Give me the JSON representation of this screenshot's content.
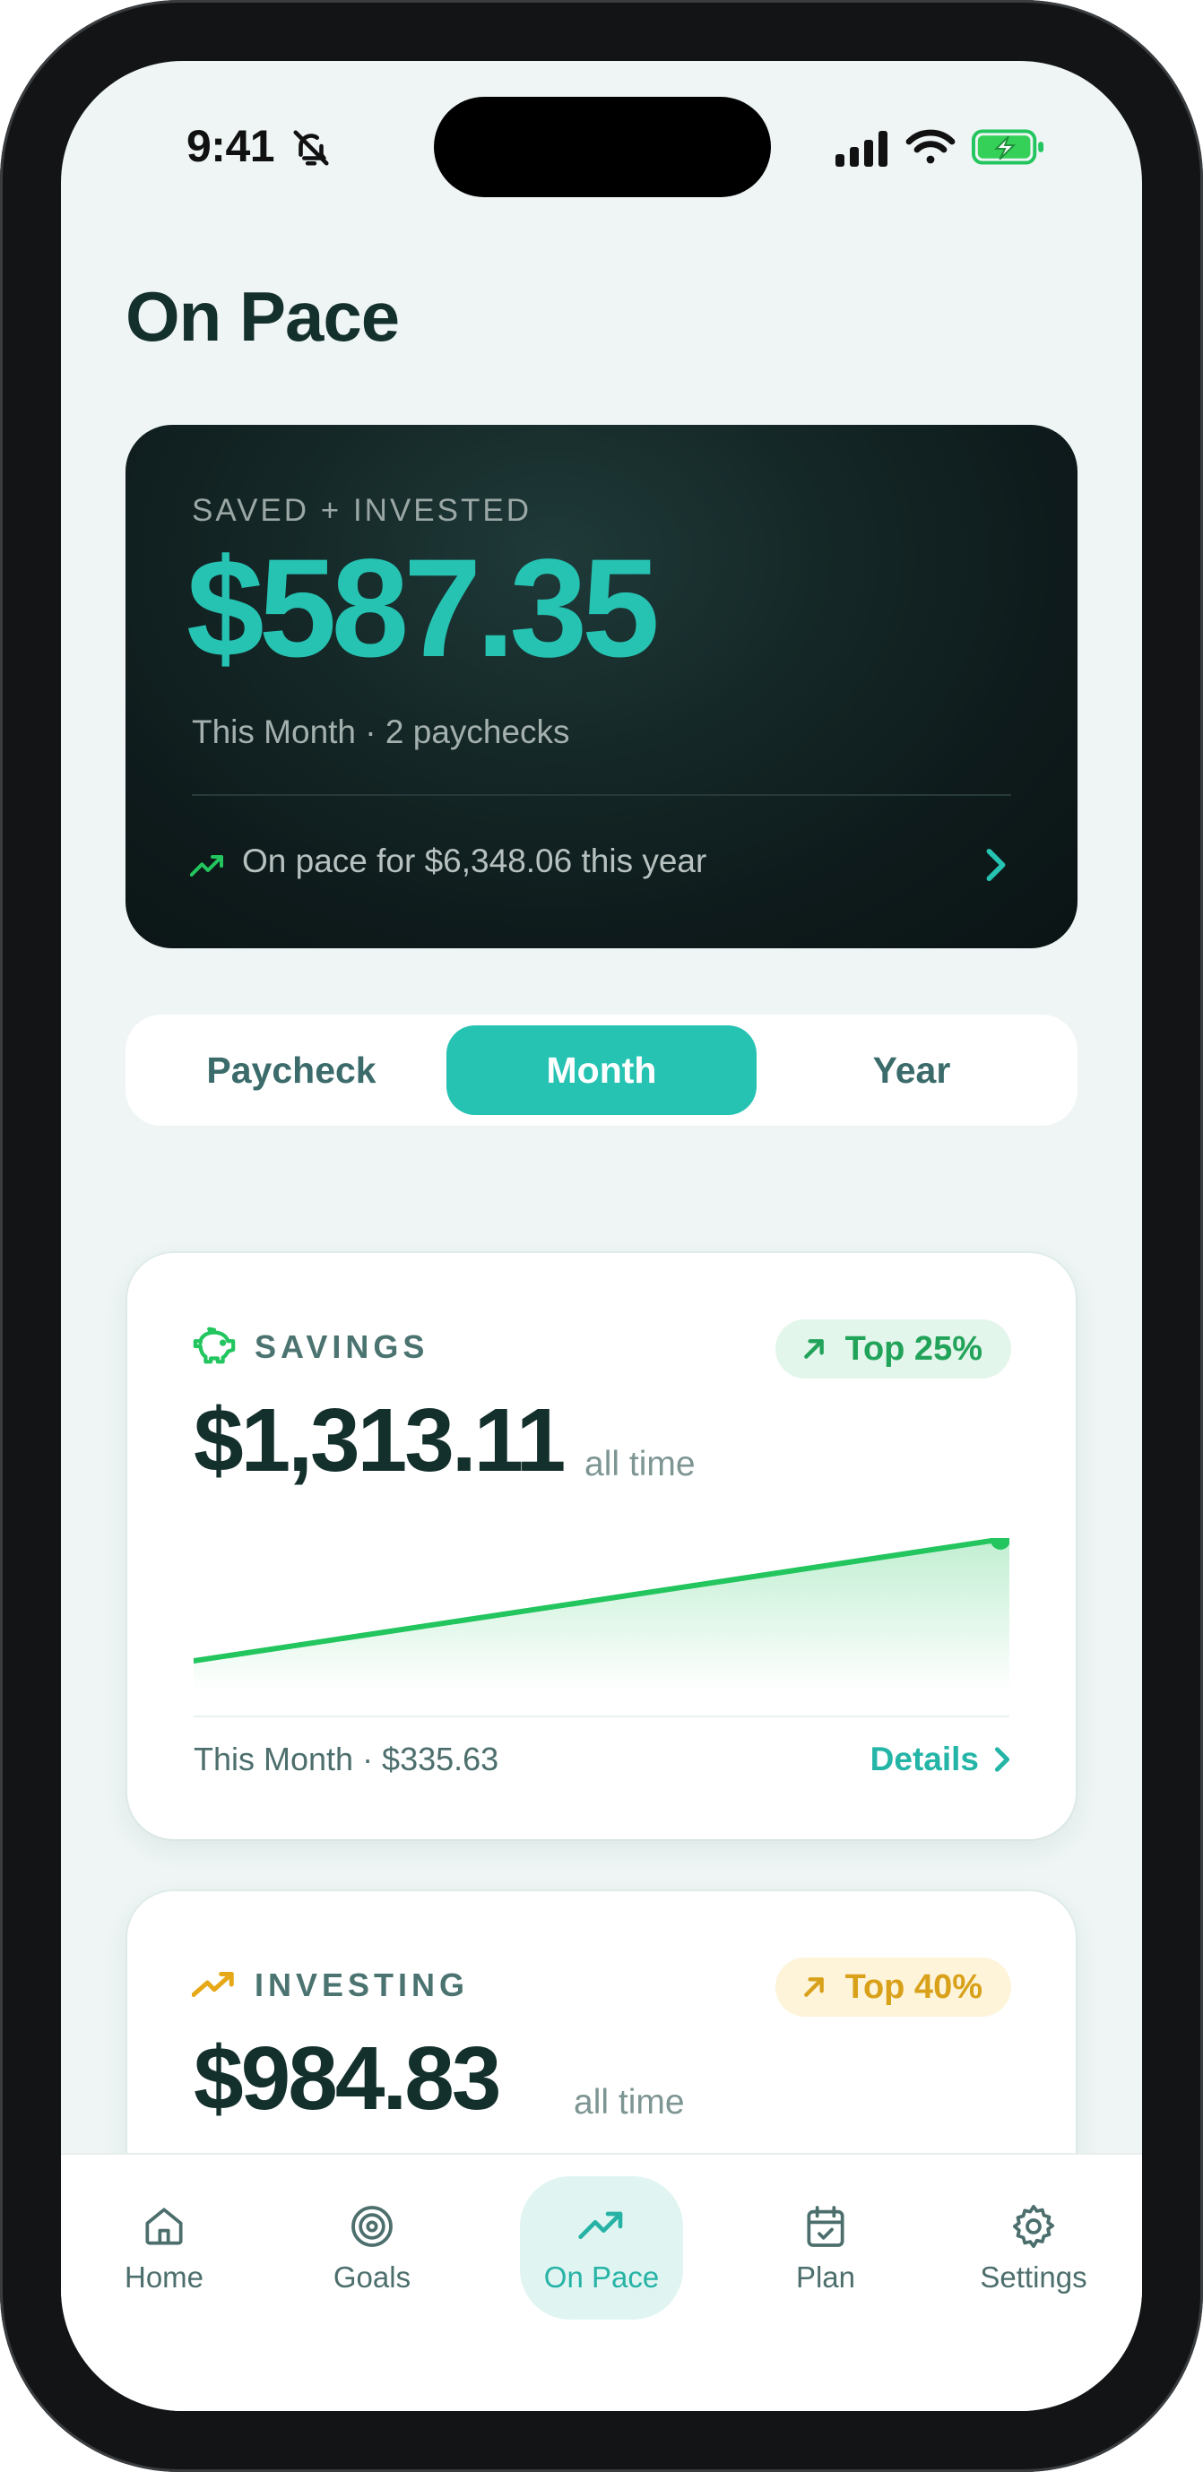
{
  "status_bar": {
    "time": "9:41"
  },
  "page": {
    "title": "On Pace"
  },
  "hero": {
    "label": "SAVED + INVESTED",
    "amount": "$587.35",
    "subtitle": "This Month · 2 paychecks",
    "pace_text": "On pace for $6,348.06 this year"
  },
  "segments": {
    "items": [
      {
        "label": "Paycheck"
      },
      {
        "label": "Month"
      },
      {
        "label": "Year"
      }
    ],
    "selected": "Month"
  },
  "savings": {
    "label": "SAVINGS",
    "badge": "Top 25%",
    "amount": "$1,313.11",
    "period": "all time",
    "footer": "This Month · $335.63",
    "details": "Details",
    "color": "#22c55e",
    "trend": {
      "start": 0.0,
      "end": 1.0
    }
  },
  "investing": {
    "label": "INVESTING",
    "badge": "Top 40%",
    "amount": "$984.83",
    "period": "all time",
    "color": "#e6a817"
  },
  "tabbar": {
    "items": [
      {
        "label": "Home",
        "icon": "home-icon"
      },
      {
        "label": "Goals",
        "icon": "target-icon"
      },
      {
        "label": "On Pace",
        "icon": "trend-up-icon"
      },
      {
        "label": "Plan",
        "icon": "calendar-check-icon"
      },
      {
        "label": "Settings",
        "icon": "gear-icon"
      }
    ],
    "active": "On Pace"
  },
  "colors": {
    "accent": "#26c2b2",
    "dark_text": "#14302c",
    "savings_green": "#22c55e",
    "investing_gold": "#e6a817"
  }
}
